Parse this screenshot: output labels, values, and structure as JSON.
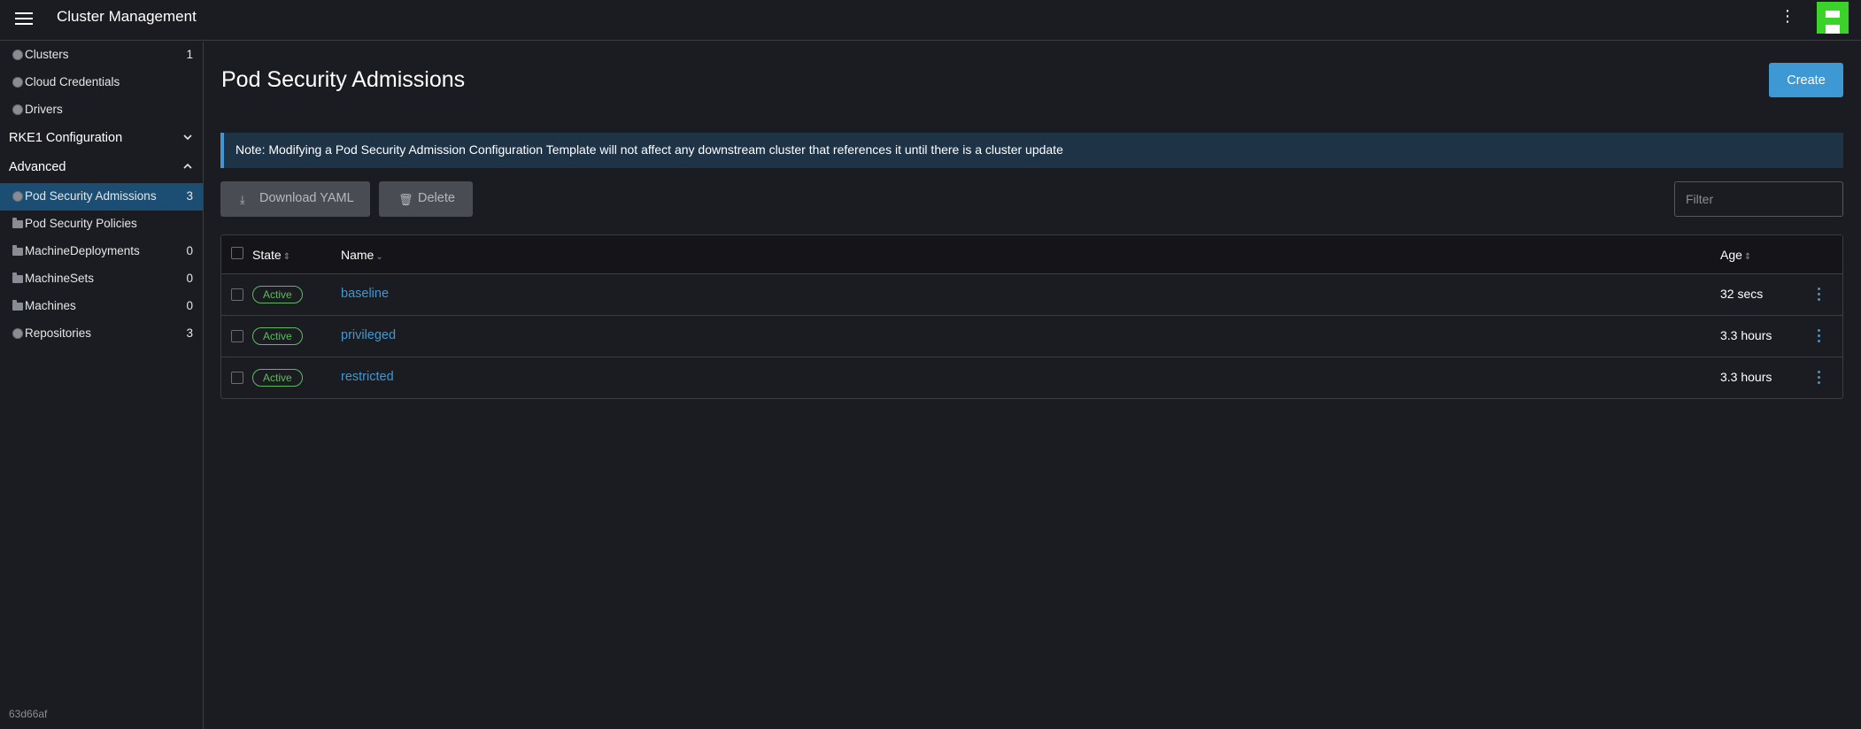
{
  "header": {
    "title": "Cluster Management"
  },
  "sidebar": {
    "top_items": [
      {
        "label": "Clusters",
        "count": "1",
        "icon": "globe-icon"
      },
      {
        "label": "Cloud Credentials",
        "count": "",
        "icon": "globe-icon"
      },
      {
        "label": "Drivers",
        "count": "",
        "icon": "globe-icon"
      }
    ],
    "groups": [
      {
        "label": "RKE1 Configuration",
        "expanded": false
      },
      {
        "label": "Advanced",
        "expanded": true
      }
    ],
    "advanced_items": [
      {
        "label": "Pod Security Admissions",
        "count": "3",
        "icon": "globe-icon",
        "active": true
      },
      {
        "label": "Pod Security Policies",
        "count": "",
        "icon": "folder-icon"
      },
      {
        "label": "MachineDeployments",
        "count": "0",
        "icon": "folder-icon"
      },
      {
        "label": "MachineSets",
        "count": "0",
        "icon": "folder-icon"
      },
      {
        "label": "Machines",
        "count": "0",
        "icon": "folder-icon"
      },
      {
        "label": "Repositories",
        "count": "3",
        "icon": "globe-icon"
      }
    ],
    "version": "63d66af"
  },
  "main": {
    "title": "Pod Security Admissions",
    "create_label": "Create",
    "banner": "Note: Modifying a Pod Security Admission Configuration Template will not affect any downstream cluster that references it until there is a cluster update",
    "download_label": "Download YAML",
    "delete_label": "Delete",
    "filter_placeholder": "Filter",
    "columns": {
      "state": "State",
      "name": "Name",
      "age": "Age"
    },
    "rows": [
      {
        "state": "Active",
        "name": "baseline",
        "age": "32 secs"
      },
      {
        "state": "Active",
        "name": "privileged",
        "age": "3.3 hours"
      },
      {
        "state": "Active",
        "name": "restricted",
        "age": "3.3 hours"
      }
    ]
  },
  "colors": {
    "accent": "#3d98d3",
    "active_badge": "#5dbb5d",
    "background": "#1b1c21",
    "sidebar_active": "#1c4e73"
  }
}
